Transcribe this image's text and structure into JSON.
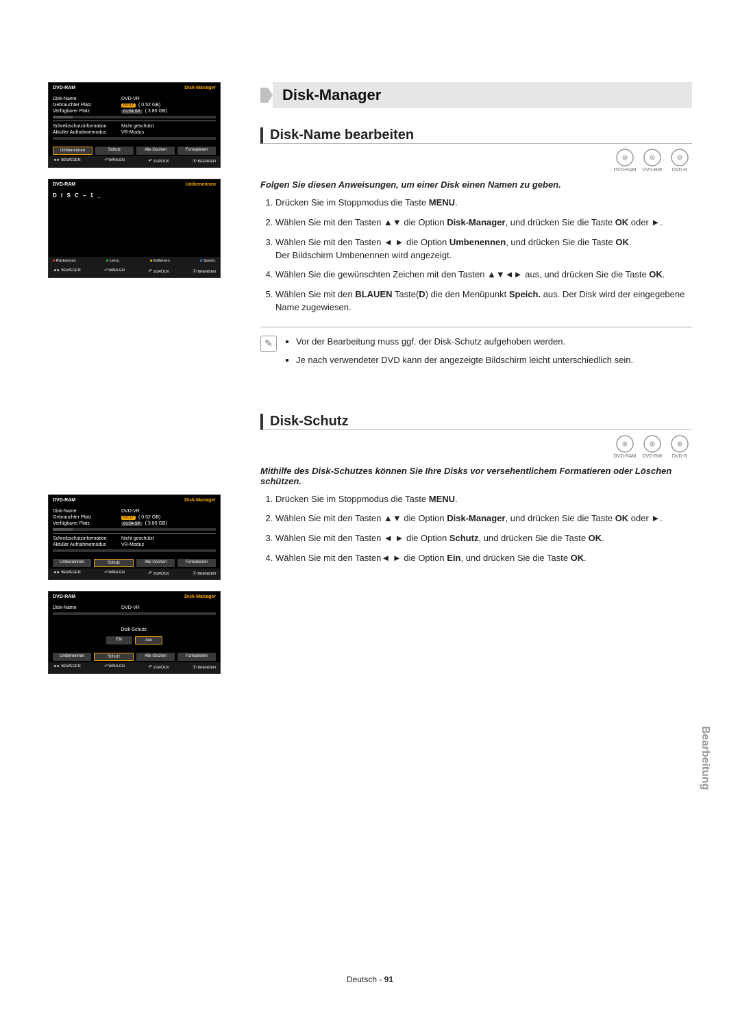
{
  "page": {
    "title": "Disk-Manager",
    "section1": "Disk-Name bearbeiten",
    "section2": "Disk-Schutz",
    "side_tab": "Bearbeitung",
    "footer_lang": "Deutsch - ",
    "footer_page": "91"
  },
  "discs": [
    "DVD-RAM",
    "DVD-RW",
    "DVD-R"
  ],
  "s1": {
    "intro": "Folgen Sie diesen Anweisungen, um einer Disk einen Namen zu geben.",
    "steps": [
      "Drücken Sie im Stoppmodus die Taste <b>MENU</b>.",
      "Wählen Sie mit den Tasten ▲▼ die Option <b>Disk-Manager</b>, und drücken Sie die Taste <b>OK</b> oder ►.",
      "Wählen Sie mit den Tasten ◄ ► die Option <b>Umbenennen</b>, und drücken Sie die Taste <b>OK</b>.<br>Der Bildschirm Umbenennen wird angezeigt.",
      "Wählen Sie die gewünschten Zeichen mit den Tasten ▲▼◄► aus, und drücken Sie die Taste <b>OK</b>.",
      "Wählen Sie mit den <b>BLAUEN</b> Taste(<b>D</b>) die den Menüpunkt <b>Speich.</b> aus. Der Disk wird der eingegebene Name zugewiesen."
    ],
    "notes": [
      "Vor der Bearbeitung muss ggf. der Disk-Schutz aufgehoben werden.",
      "Je nach verwendeter DVD kann der angezeigte Bildschirm leicht unterschiedlich sein."
    ]
  },
  "s2": {
    "intro": "Mithilfe des Disk-Schutzes können Sie Ihre Disks vor versehentlichem Formatieren oder Löschen schützen.",
    "steps": [
      "Drücken Sie im Stoppmodus die Taste <b>MENU</b>.",
      "Wählen Sie mit den Tasten ▲▼ die Option <b>Disk-Manager</b>, und drücken Sie die Taste <b>OK</b> oder ►.",
      "Wählen Sie mit den Tasten ◄ ► die Option <b>Schutz</b>, und drücken Sie die Taste <b>OK</b>.",
      "Wählen Sie mit den Tasten◄ ► die Option <b>Ein</b>, und drücken Sie die Taste <b>OK</b>."
    ]
  },
  "osd": {
    "header_left": "DVD-RAM",
    "header_right": "Disk-Manager",
    "header_right_rename": "Umbenennen",
    "rows": {
      "name": "Disk-Name",
      "name_val": "DVD-VR",
      "used": "Gebrauchter Platz",
      "used_t": "00:17",
      "used_s": "( 0.52 GB)",
      "avail": "Verfügbarer Platz",
      "avail_t": "01:54 SP",
      "avail_s": "( 3.85 GB)",
      "prot": "Schreibschutzinformation",
      "prot_v": "Nicht geschützt",
      "mode": "Aktuller Aufnahmemodus",
      "mode_v": "VR-Modus"
    },
    "buttons": [
      "Umbenennen",
      "Schutz",
      "Alle löschen",
      "Formatieren"
    ],
    "footer": {
      "move": "BEWEGEN",
      "select": "WÄHLEN",
      "back": "ZURÜCK",
      "exit": "BEENDEN"
    },
    "rename_footer": {
      "a": "Rücksetzen",
      "b": "Leerz.",
      "c": "Entfernen",
      "d": "Speich."
    },
    "disc_label": "D I S C – 1 _",
    "protect_title": "Disk-Schutz:",
    "protect_on": "Ein",
    "protect_off": "Aus"
  }
}
